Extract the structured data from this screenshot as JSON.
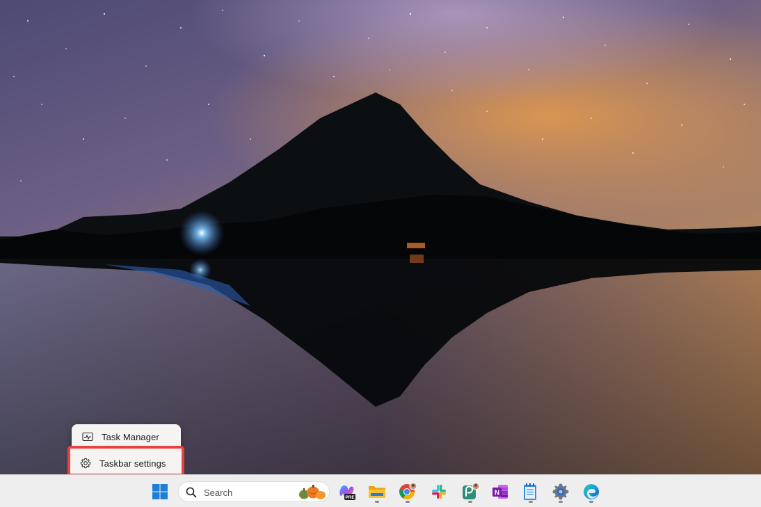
{
  "context_menu": {
    "items": [
      {
        "label": "Task Manager",
        "icon": "task-manager-icon"
      },
      {
        "label": "Taskbar settings",
        "icon": "gear-icon"
      }
    ],
    "highlight_color": "#e8423f"
  },
  "taskbar": {
    "search": {
      "placeholder": "Search",
      "icon": "search-icon",
      "highlight_icon": "pumpkins-icon"
    },
    "apps": [
      {
        "name": "windows-start-icon",
        "running": false
      },
      {
        "name": "copilot-pre-icon",
        "running": false
      },
      {
        "name": "file-explorer-icon",
        "running": true
      },
      {
        "name": "chrome-icon",
        "running": true
      },
      {
        "name": "slack-icon",
        "running": false
      },
      {
        "name": "chatgpt-profile-icon",
        "running": true
      },
      {
        "name": "onenote-icon",
        "running": false
      },
      {
        "name": "notepad-icon",
        "running": true
      },
      {
        "name": "settings-icon",
        "running": true
      },
      {
        "name": "edge-icon",
        "running": true
      }
    ],
    "background": "#eeeeee"
  },
  "wallpaper": {
    "subject": "mountain-lake-night-icon"
  }
}
